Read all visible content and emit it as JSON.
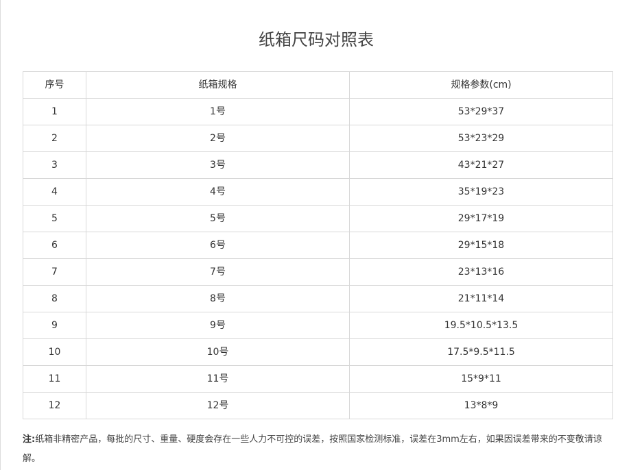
{
  "title": "纸箱尺码对照表",
  "table": {
    "headers": [
      "序号",
      "纸箱规格",
      "规格参数(cm)"
    ],
    "rows": [
      [
        "1",
        "1号",
        "53*29*37"
      ],
      [
        "2",
        "2号",
        "53*23*29"
      ],
      [
        "3",
        "3号",
        "43*21*27"
      ],
      [
        "4",
        "4号",
        "35*19*23"
      ],
      [
        "5",
        "5号",
        "29*17*19"
      ],
      [
        "6",
        "6号",
        "29*15*18"
      ],
      [
        "7",
        "7号",
        "23*13*16"
      ],
      [
        "8",
        "8号",
        "21*11*14"
      ],
      [
        "9",
        "9号",
        "19.5*10.5*13.5"
      ],
      [
        "10",
        "10号",
        "17.5*9.5*11.5"
      ],
      [
        "11",
        "11号",
        "15*9*11"
      ],
      [
        "12",
        "12号",
        "13*8*9"
      ]
    ]
  },
  "note": {
    "label": "注:",
    "text": "纸箱非精密产品，每批的尺寸、重量、硬度会存在一些人力不可控的误差，按照国家检测标准，误差在3mm左右，如果因误差带来的不变敬请谅解。"
  }
}
